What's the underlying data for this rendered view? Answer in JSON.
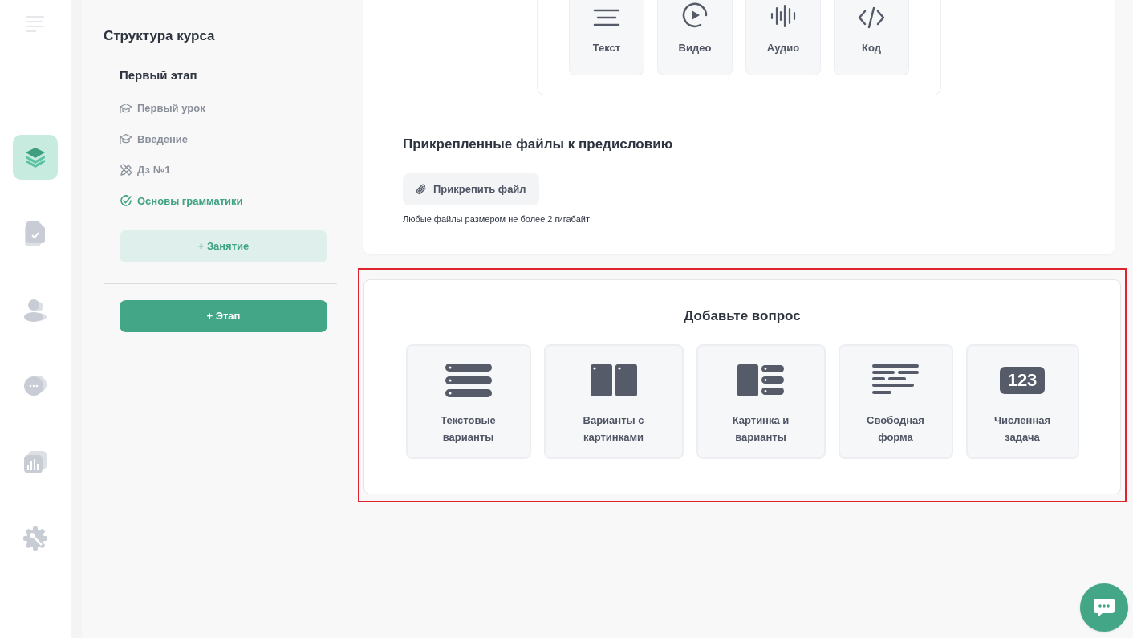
{
  "rail": [
    {
      "kind": "courses",
      "selected": true
    },
    {
      "kind": "tasks",
      "selected": false
    },
    {
      "kind": "students",
      "selected": false
    },
    {
      "kind": "chat",
      "selected": false
    },
    {
      "kind": "stats",
      "selected": false
    },
    {
      "kind": "settings",
      "selected": false
    }
  ],
  "structure": {
    "title": "Структура курса",
    "stages": [
      {
        "title": "Первый этап",
        "lessons": [
          {
            "kind": "lesson",
            "label": "Первый урок",
            "selected": false
          },
          {
            "kind": "lesson",
            "label": "Введение",
            "selected": false
          },
          {
            "kind": "homework",
            "label": "Дз №1",
            "selected": false
          },
          {
            "kind": "lesson",
            "label": "Основы грамматики",
            "selected": true
          }
        ],
        "add_lesson": "+ Занятие"
      }
    ],
    "add_stage": "+ Этап"
  },
  "content_blocks": [
    {
      "kind": "text",
      "label": "Текст"
    },
    {
      "kind": "video",
      "label": "Видео"
    },
    {
      "kind": "audio",
      "label": "Аудио"
    },
    {
      "kind": "code",
      "label": "Код"
    }
  ],
  "attachments": {
    "title": "Прикрепленные файлы к предисловию",
    "button": "Прикрепить файл",
    "note": "Любые файлы размером не более 2 гигабайт"
  },
  "question": {
    "title": "Добавьте вопрос",
    "highlighted": true,
    "types": [
      {
        "kind": "text_options",
        "label": "Текстовые варианты"
      },
      {
        "kind": "image_options",
        "label": "Варианты с картинками"
      },
      {
        "kind": "image_and_options",
        "label": "Картинка и варианты"
      },
      {
        "kind": "free_form",
        "label": "Свободная форма"
      },
      {
        "kind": "numeric",
        "label": "Численная задача",
        "icon_text": "123"
      }
    ]
  }
}
